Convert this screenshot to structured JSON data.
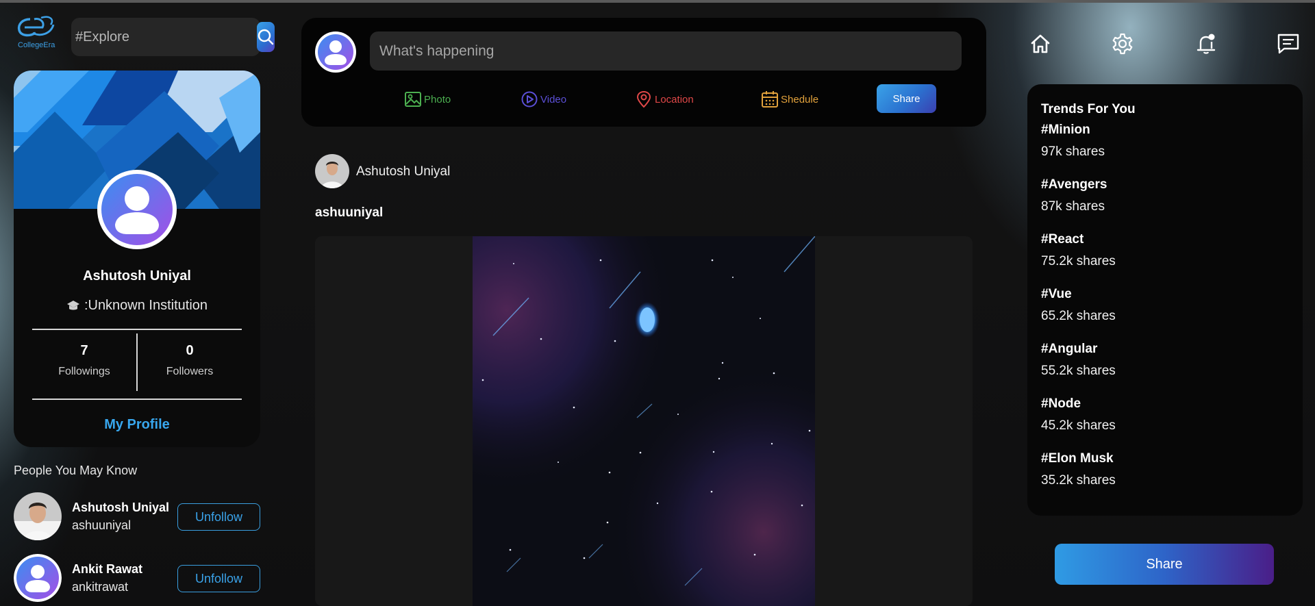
{
  "brand": {
    "name": "CollegeEra",
    "accent": "#38a7ee"
  },
  "search": {
    "placeholder": "#Explore",
    "icon": "search-icon"
  },
  "profile_card": {
    "name": "Ashutosh Uniyal",
    "institution": ":Unknown Institution",
    "followings_count": "7",
    "followings_label": "Followings",
    "followers_count": "0",
    "followers_label": "Followers",
    "my_profile_label": "My Profile"
  },
  "people_you_may_know": {
    "title": "People You May Know",
    "people": [
      {
        "name": "Ashutosh Uniyal",
        "username": "ashuuniyal",
        "button": "Unfollow"
      },
      {
        "name": "Ankit Rawat",
        "username": "ankitrawat",
        "button": "Unfollow"
      }
    ]
  },
  "composer": {
    "placeholder": "What's happening",
    "options": [
      {
        "label": "Photo",
        "icon": "photo-icon",
        "color": "#4caf50"
      },
      {
        "label": "Video",
        "icon": "video-icon",
        "color": "#5b4fd6"
      },
      {
        "label": "Location",
        "icon": "location-icon",
        "color": "#e04848"
      },
      {
        "label": "Shedule",
        "icon": "calendar-icon",
        "color": "#e2a23c"
      }
    ],
    "share_label": "Share"
  },
  "post": {
    "author": "Ashutosh Uniyal",
    "caption": "ashuuniyal"
  },
  "nav": {
    "icons": [
      "home-icon",
      "gear-icon",
      "notification-bell-icon",
      "message-icon"
    ]
  },
  "trends": {
    "title": "Trends For You",
    "items": [
      {
        "tag": "#Minion",
        "shares": "97k shares"
      },
      {
        "tag": "#Avengers",
        "shares": "87k shares"
      },
      {
        "tag": "#React",
        "shares": "75.2k shares"
      },
      {
        "tag": "#Vue",
        "shares": "65.2k shares"
      },
      {
        "tag": "#Angular",
        "shares": "55.2k shares"
      },
      {
        "tag": "#Node",
        "shares": "45.2k shares"
      },
      {
        "tag": "#Elon Musk",
        "shares": "35.2k shares"
      }
    ]
  },
  "right_share_label": "Share"
}
